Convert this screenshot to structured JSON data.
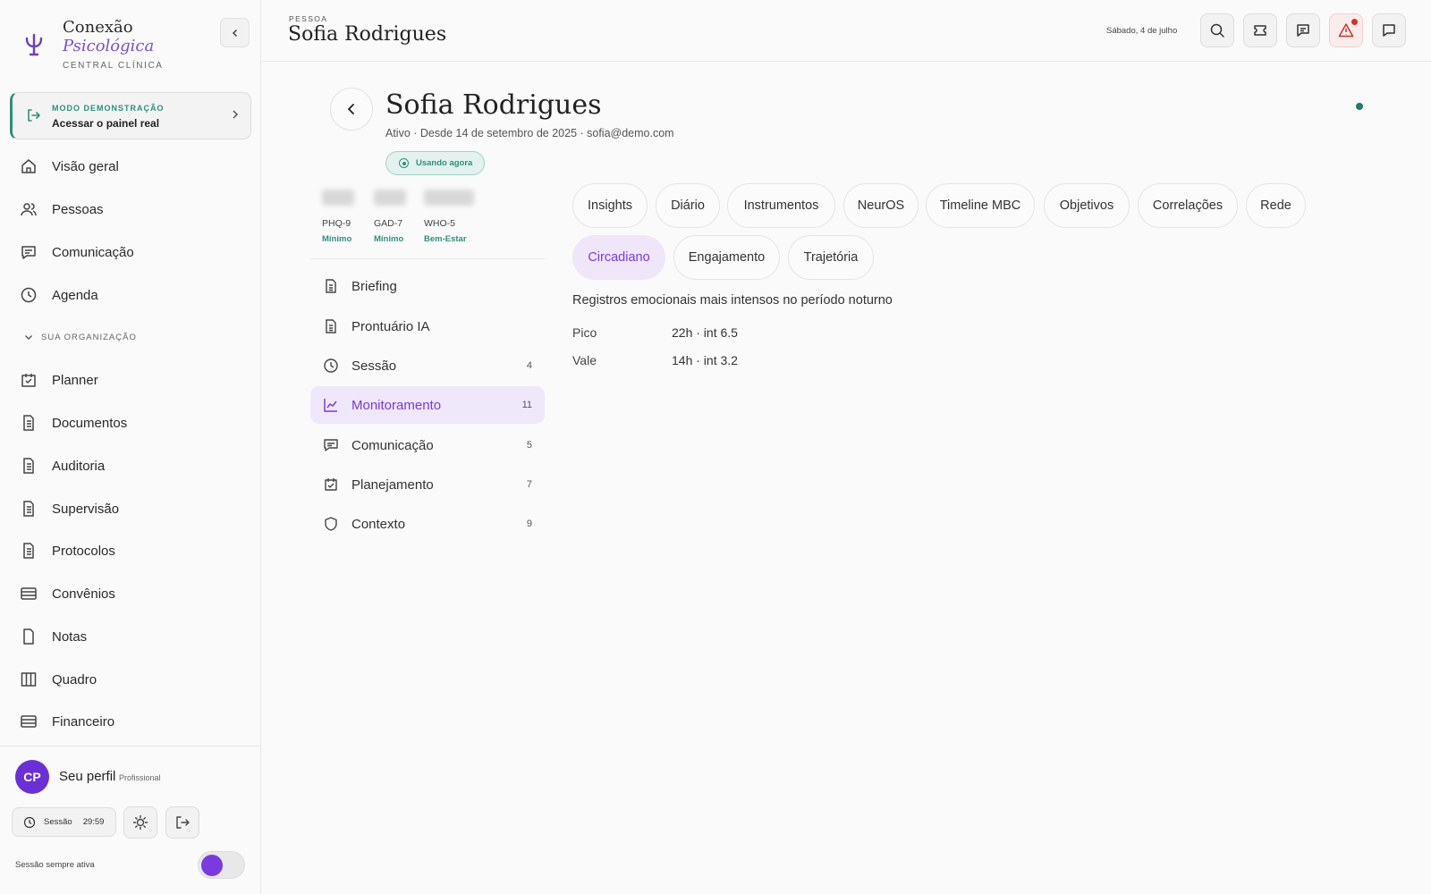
{
  "brand": {
    "name": "Conexão",
    "sub": "Psicológica",
    "tagline": "CENTRAL CLÍNICA"
  },
  "demo": {
    "tag": "MODO DEMONSTRAÇÃO",
    "title": "Acessar o painel real"
  },
  "nav": {
    "overview": "Visão geral",
    "people": "Pessoas",
    "communication": "Comunicação",
    "agenda": "Agenda",
    "section": "SUA ORGANIZAÇÃO",
    "planner": "Planner",
    "documents": "Documentos",
    "audit": "Auditoria",
    "supervision": "Supervisão",
    "protocols": "Protocolos",
    "insurance": "Convênios",
    "notes": "Notas",
    "board": "Quadro",
    "finance": "Financeiro"
  },
  "profile": {
    "initials": "CP",
    "name": "Seu perfil",
    "role": "Profissional"
  },
  "session": {
    "label": "Sessão",
    "time": "29:59",
    "always_label": "Sessão sempre ativa",
    "always_on": true
  },
  "header": {
    "crumb": "PESSOA",
    "title": "Sofia Rodrigues",
    "date": "Sábado, 4 de julho"
  },
  "person": {
    "name": "Sofia Rodrigues",
    "meta": "Ativo · Desde 14 de setembro de 2025 · sofia@demo.com",
    "badge": "Usando agora"
  },
  "scores": [
    {
      "name": "PHQ-9",
      "level": "Mínimo"
    },
    {
      "name": "GAD-7",
      "level": "Mínimo"
    },
    {
      "name": "WHO-5",
      "level": "Bem-Estar"
    }
  ],
  "sections": {
    "briefing": {
      "label": "Briefing"
    },
    "record": {
      "label": "Prontuário IA"
    },
    "session": {
      "label": "Sessão",
      "count": "4"
    },
    "monitoring": {
      "label": "Monitoramento",
      "count": "11"
    },
    "communication": {
      "label": "Comunicação",
      "count": "5"
    },
    "planning": {
      "label": "Planejamento",
      "count": "7"
    },
    "context": {
      "label": "Contexto",
      "count": "9"
    }
  },
  "tabs": {
    "insights": "Insights",
    "diary": "Diário",
    "instruments": "Instrumentos",
    "neuros": "NeurOS",
    "timeline": "Timeline MBC",
    "goals": "Objetivos",
    "correlations": "Correlações",
    "network": "Rede",
    "circadian": "Circadiano",
    "engagement": "Engajamento",
    "trajectory": "Trajetória"
  },
  "circadian": {
    "title": "Registros emocionais mais intensos no período noturno",
    "peak_label": "Pico",
    "peak_value": "22h · int 6.5",
    "valley_label": "Vale",
    "valley_value": "14h · int 3.2"
  },
  "colors": {
    "accent": "#7a3ae0",
    "teal": "#2f8f7a",
    "alert": "#d93025"
  }
}
